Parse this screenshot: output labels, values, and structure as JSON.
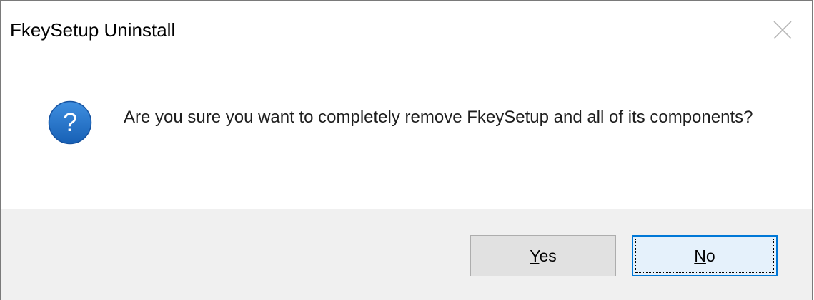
{
  "window": {
    "title": "FkeySetup Uninstall",
    "close_icon": "close-icon"
  },
  "message": {
    "icon": "question-icon",
    "text": "Are you sure you want to completely remove FkeySetup and all of its components?"
  },
  "buttons": {
    "yes": {
      "mnemonic": "Y",
      "rest": "es"
    },
    "no": {
      "mnemonic": "N",
      "rest": "o"
    }
  },
  "colors": {
    "icon_blue": "#1f6fbf",
    "focus_border": "#0078d7",
    "footer_bg": "#f0f0f0"
  }
}
